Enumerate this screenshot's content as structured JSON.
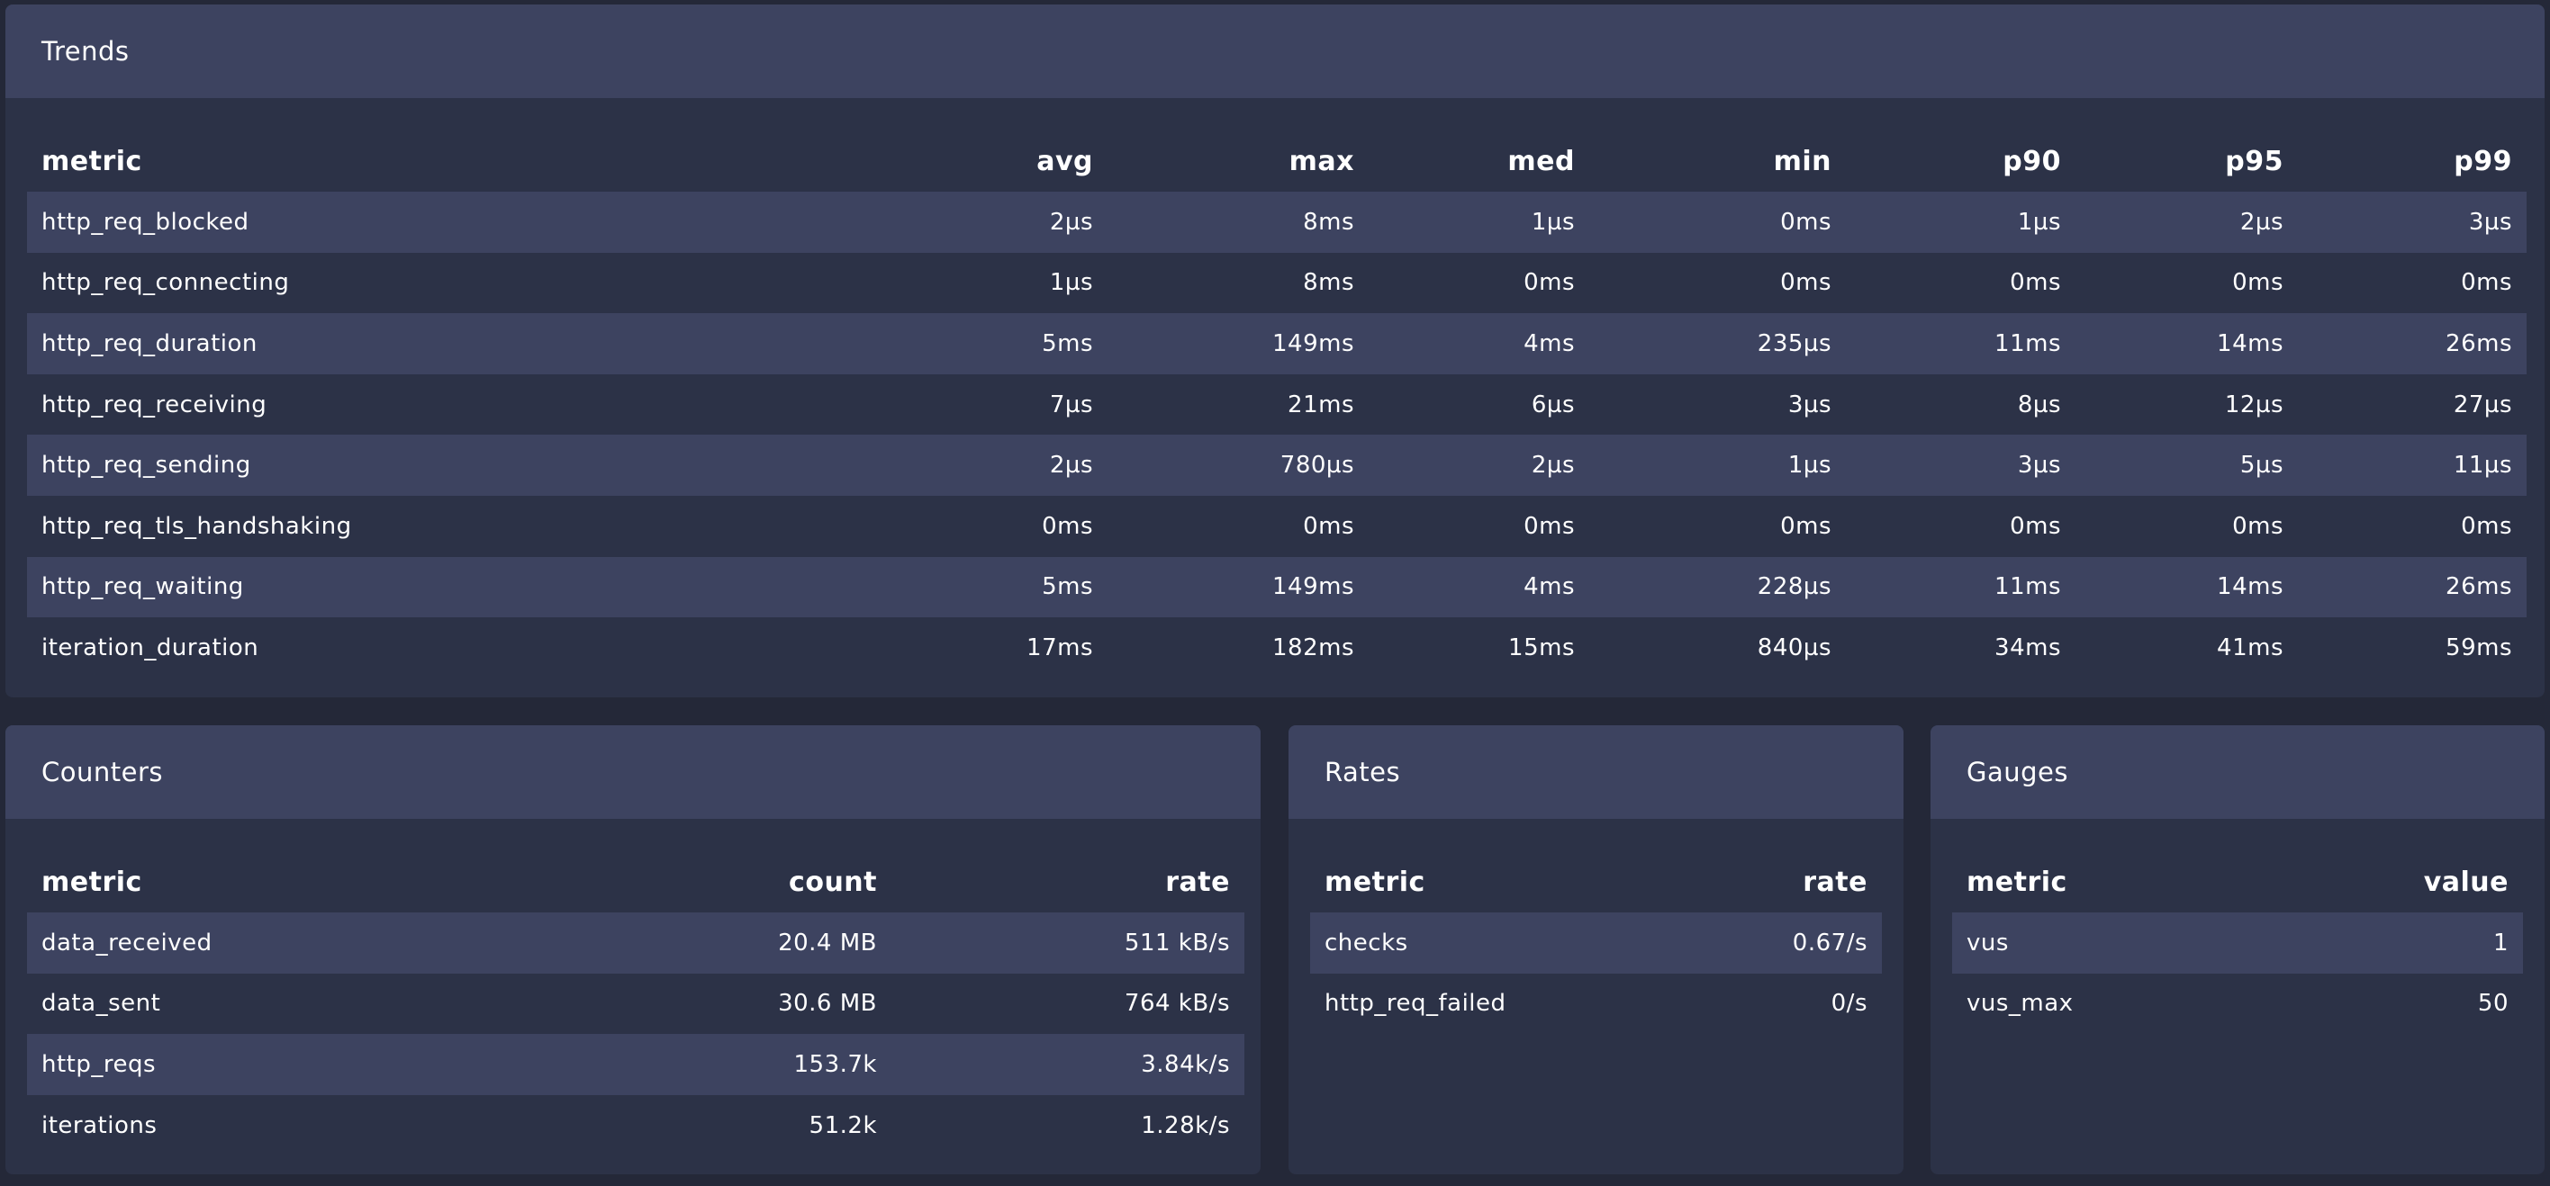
{
  "trends": {
    "title": "Trends",
    "columns": [
      "metric",
      "avg",
      "max",
      "med",
      "min",
      "p90",
      "p95",
      "p99"
    ],
    "rows": [
      [
        "http_req_blocked",
        "2µs",
        "8ms",
        "1µs",
        "0ms",
        "1µs",
        "2µs",
        "3µs"
      ],
      [
        "http_req_connecting",
        "1µs",
        "8ms",
        "0ms",
        "0ms",
        "0ms",
        "0ms",
        "0ms"
      ],
      [
        "http_req_duration",
        "5ms",
        "149ms",
        "4ms",
        "235µs",
        "11ms",
        "14ms",
        "26ms"
      ],
      [
        "http_req_receiving",
        "7µs",
        "21ms",
        "6µs",
        "3µs",
        "8µs",
        "12µs",
        "27µs"
      ],
      [
        "http_req_sending",
        "2µs",
        "780µs",
        "2µs",
        "1µs",
        "3µs",
        "5µs",
        "11µs"
      ],
      [
        "http_req_tls_handshaking",
        "0ms",
        "0ms",
        "0ms",
        "0ms",
        "0ms",
        "0ms",
        "0ms"
      ],
      [
        "http_req_waiting",
        "5ms",
        "149ms",
        "4ms",
        "228µs",
        "11ms",
        "14ms",
        "26ms"
      ],
      [
        "iteration_duration",
        "17ms",
        "182ms",
        "15ms",
        "840µs",
        "34ms",
        "41ms",
        "59ms"
      ]
    ]
  },
  "counters": {
    "title": "Counters",
    "columns": [
      "metric",
      "count",
      "rate"
    ],
    "rows": [
      [
        "data_received",
        "20.4 MB",
        "511 kB/s"
      ],
      [
        "data_sent",
        "30.6 MB",
        "764 kB/s"
      ],
      [
        "http_reqs",
        "153.7k",
        "3.84k/s"
      ],
      [
        "iterations",
        "51.2k",
        "1.28k/s"
      ]
    ]
  },
  "rates": {
    "title": "Rates",
    "columns": [
      "metric",
      "rate"
    ],
    "rows": [
      [
        "checks",
        "0.67/s"
      ],
      [
        "http_req_failed",
        "0/s"
      ]
    ]
  },
  "gauges": {
    "title": "Gauges",
    "columns": [
      "metric",
      "value"
    ],
    "rows": [
      [
        "vus",
        "1"
      ],
      [
        "vus_max",
        "50"
      ]
    ]
  },
  "colors": {
    "background": "#242838",
    "card": "#2c3247",
    "header": "#3d4360",
    "stripe": "#3d4360"
  }
}
